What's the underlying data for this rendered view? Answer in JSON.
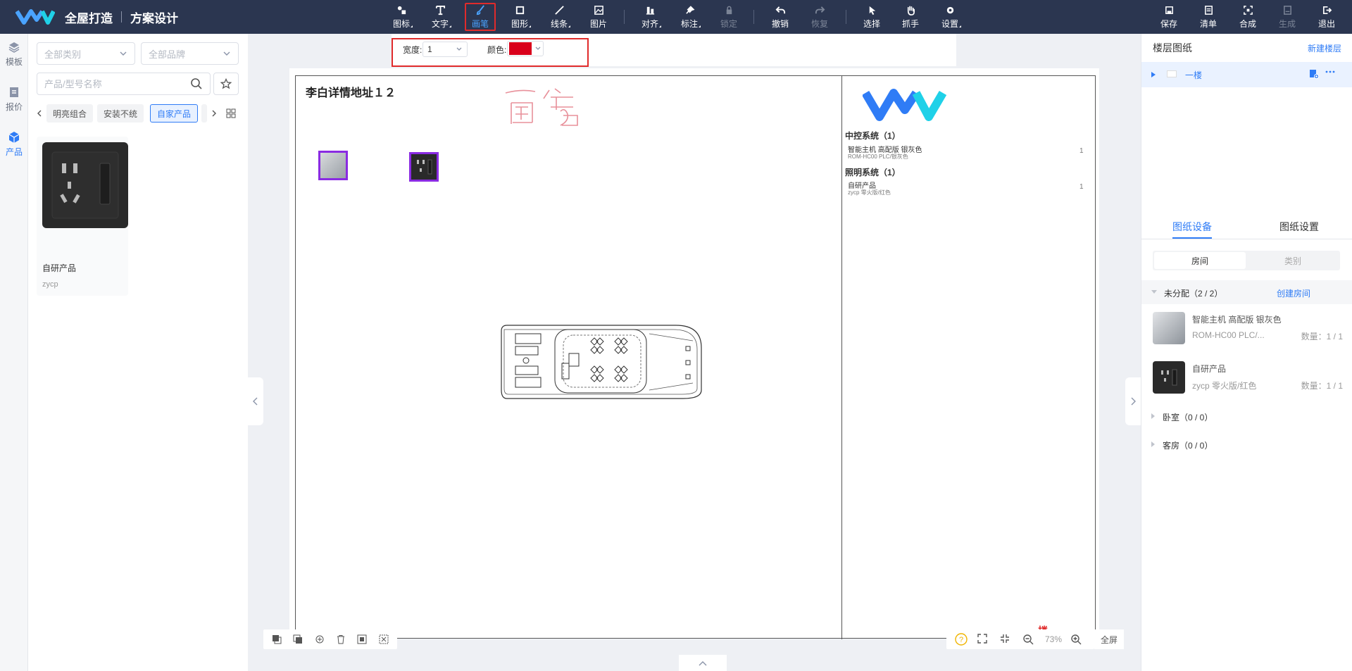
{
  "brand": {
    "title": "全屋打造",
    "subtitle": "方案设计"
  },
  "toolbar": {
    "tools": [
      {
        "label": "图标",
        "icon": "icon-library-icon"
      },
      {
        "label": "文字",
        "icon": "text-icon"
      },
      {
        "label": "画笔",
        "icon": "brush-icon"
      },
      {
        "label": "图形",
        "icon": "shape-icon"
      },
      {
        "label": "线条",
        "icon": "line-icon"
      },
      {
        "label": "图片",
        "icon": "image-icon"
      },
      {
        "label": "对齐",
        "icon": "align-icon"
      },
      {
        "label": "标注",
        "icon": "pin-icon"
      },
      {
        "label": "锁定",
        "icon": "lock-icon"
      },
      {
        "label": "撤销",
        "icon": "undo-icon"
      },
      {
        "label": "恢复",
        "icon": "redo-icon"
      },
      {
        "label": "选择",
        "icon": "pointer-icon"
      },
      {
        "label": "抓手",
        "icon": "hand-icon"
      },
      {
        "label": "设置",
        "icon": "gear-icon"
      }
    ],
    "right_tools": [
      {
        "label": "保存",
        "icon": "save-icon"
      },
      {
        "label": "清单",
        "icon": "list-icon"
      },
      {
        "label": "合成",
        "icon": "compose-icon"
      },
      {
        "label": "生成",
        "icon": "generate-icon"
      },
      {
        "label": "退出",
        "icon": "exit-icon"
      }
    ]
  },
  "rail": {
    "items": [
      {
        "label": "模板"
      },
      {
        "label": "报价"
      },
      {
        "label": "产品"
      }
    ]
  },
  "filters": {
    "category": "全部类别",
    "brand": "全部品牌",
    "search_placeholder": "产品/型号名称",
    "chips": [
      "明亮组合",
      "安装不统",
      "自家产品"
    ]
  },
  "product": {
    "name": "自研产品",
    "code": "zycp"
  },
  "pen": {
    "width_label": "宽度:",
    "width_value": "1",
    "color_label": "颜色:",
    "color": "#d9001b"
  },
  "plan": {
    "title": "李白详情地址１２",
    "handwriting": "画笔",
    "floor_tag": "一楼",
    "legend": [
      {
        "heading": "中控系统（1）",
        "item": "智能主机 高配版 银灰色",
        "sub": "ROM-HC00 PLC/银灰色",
        "qty": "1"
      },
      {
        "heading": "照明系统（1）",
        "item": "自研产品",
        "sub": "zycp 零火版/红色",
        "qty": "1"
      }
    ]
  },
  "zoom": {
    "level": "73%",
    "fullscreen": "全屏"
  },
  "right": {
    "title": "楼层图纸",
    "new_floor": "新建楼层",
    "floor_name": "一楼",
    "tabs": [
      "图纸设备",
      "图纸设置"
    ],
    "segments": [
      "房间",
      "类别"
    ],
    "unassigned": "未分配（2 / 2）",
    "create_room": "创建房间",
    "items": [
      {
        "name": "智能主机 高配版 银灰色",
        "code": "ROM-HC00 PLC/...",
        "qty": "数量：1 / 1"
      },
      {
        "name": "自研产品",
        "code": "zycp 零火版/红色",
        "qty": "数量：1 / 1"
      }
    ],
    "rooms": [
      "卧室（0 / 0）",
      "客房（0 / 0）"
    ]
  },
  "colors": {
    "topbar": "#2b3650",
    "accent": "#2f7cf6",
    "highlight": "#e02b2b",
    "device_border": "#8a2be2"
  }
}
